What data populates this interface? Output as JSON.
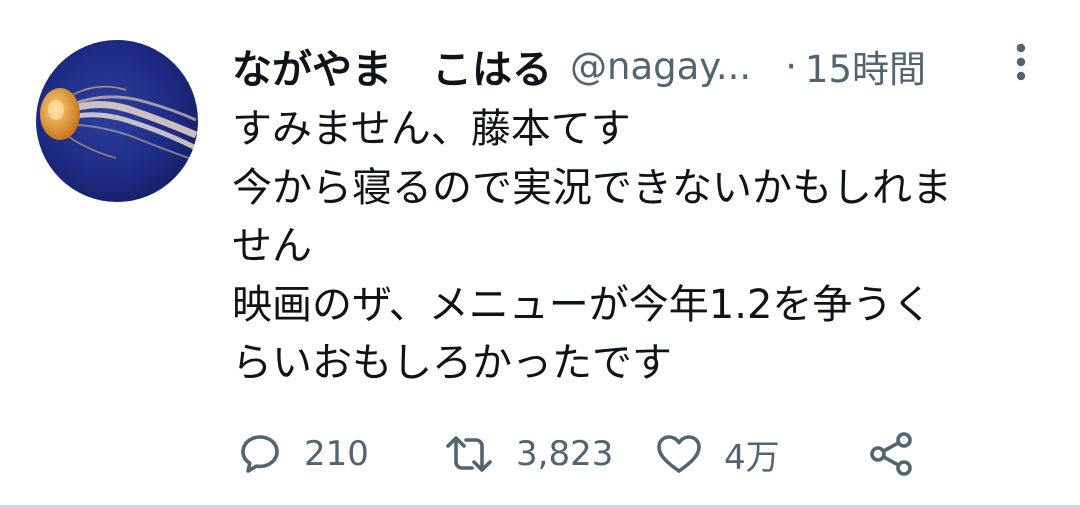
{
  "tweet": {
    "display_name": "ながやま　こはる",
    "handle": "@nagay...",
    "separator": "·",
    "time": "15時間",
    "text_lines": [
      "すみません、藤本てす",
      "今から寝るので実況できないかもしれま",
      "せん",
      "映画のザ、メニューが今年1.2を争うく",
      "らいおもしろかったです"
    ],
    "avatar_icon": "jellyfish-avatar",
    "more_icon": "more-vertical-icon"
  },
  "actions": {
    "reply": {
      "icon": "reply-icon",
      "count": "210"
    },
    "retweet": {
      "icon": "retweet-icon",
      "count": "3,823"
    },
    "like": {
      "icon": "heart-icon",
      "count": "4万"
    },
    "share": {
      "icon": "share-icon"
    }
  },
  "colors": {
    "text_primary": "#0f1419",
    "text_secondary": "#536471",
    "avatar_bg": "#1a2a7a"
  }
}
